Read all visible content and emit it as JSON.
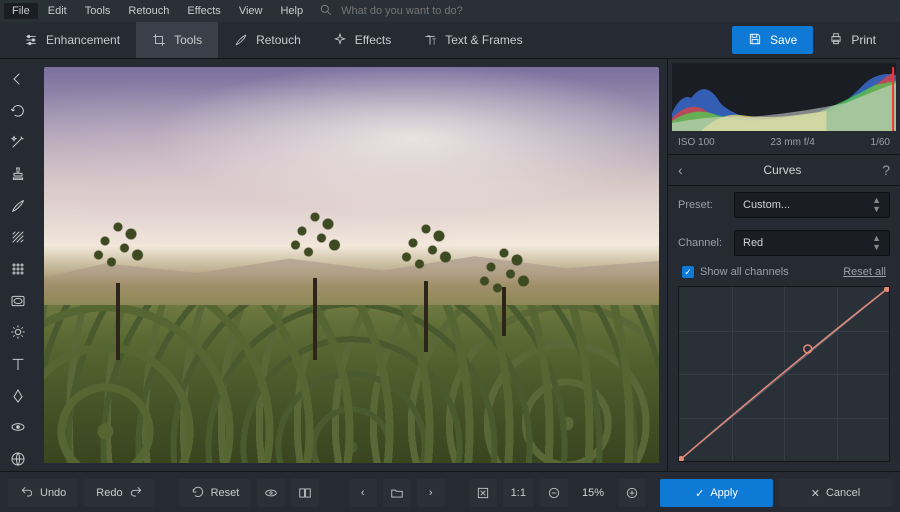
{
  "menubar": {
    "items": [
      "File",
      "Edit",
      "Tools",
      "Retouch",
      "Effects",
      "View",
      "Help"
    ],
    "active": 0,
    "search_placeholder": "What do you want to do?"
  },
  "toolbar": {
    "tabs": [
      {
        "label": "Enhancement",
        "icon": "sliders-icon"
      },
      {
        "label": "Tools",
        "icon": "crop-icon"
      },
      {
        "label": "Retouch",
        "icon": "brush-icon"
      },
      {
        "label": "Effects",
        "icon": "sparkle-icon"
      },
      {
        "label": "Text & Frames",
        "icon": "text-icon"
      }
    ],
    "active": 1,
    "save_label": "Save",
    "print_label": "Print"
  },
  "left_tools": [
    {
      "name": "back-icon"
    },
    {
      "name": "rotate-icon"
    },
    {
      "name": "magic-icon"
    },
    {
      "name": "stamp-icon"
    },
    {
      "name": "brush-icon"
    },
    {
      "name": "gradient-icon"
    },
    {
      "name": "grid-icon"
    },
    {
      "name": "vignette-icon"
    },
    {
      "name": "sun-icon"
    },
    {
      "name": "text-tool-icon"
    },
    {
      "name": "sharpen-icon"
    },
    {
      "name": "redeye-icon"
    },
    {
      "name": "globe-icon"
    }
  ],
  "histogram": {
    "iso": "ISO 100",
    "lens": "23 mm f/4",
    "shutter": "1/60"
  },
  "curves": {
    "title": "Curves",
    "preset_label": "Preset:",
    "preset_value": "Custom...",
    "channel_label": "Channel:",
    "channel_value": "Red",
    "show_all_label": "Show all channels",
    "show_all_checked": true,
    "reset_label": "Reset all",
    "apply_label": "Apply",
    "cancel_label": "Cancel"
  },
  "statusbar": {
    "undo": "Undo",
    "redo": "Redo",
    "reset": "Reset",
    "ratio": "1:1",
    "zoom": "15%"
  },
  "colors": {
    "accent": "#0e7ad6",
    "curve": "#e68a7a"
  }
}
